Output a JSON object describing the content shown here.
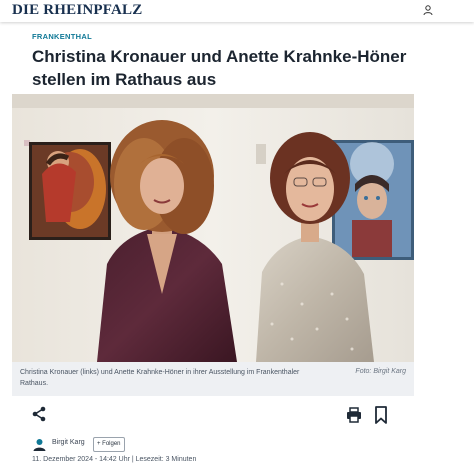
{
  "header": {
    "logo": "DIE RHEINPFALZ",
    "user_icon": "user-icon"
  },
  "article": {
    "kicker": "FRANKENTHAL",
    "headline": "Christina Kronauer und Anette Krahnke-Höner stellen im Rathaus aus",
    "caption": "Christina Kronauer (links) und Anette Krahnke-Höner in ihrer Ausstellung im Frankenthaler Rathaus.",
    "photo_credit": "Foto: Birgit Karg"
  },
  "actions": {
    "share_icon": "share-icon",
    "print_icon": "printer-icon",
    "bookmark_icon": "bookmark-icon"
  },
  "author": {
    "name": "Birgit Karg",
    "follow_label": "+ Folgen",
    "meta": "11. Dezember 2024 - 14:42 Uhr | Lesezeit: 3 Minuten"
  },
  "colors": {
    "brand": "#18304f",
    "kicker": "#0f7896",
    "caption_bg": "#eef0f3"
  }
}
